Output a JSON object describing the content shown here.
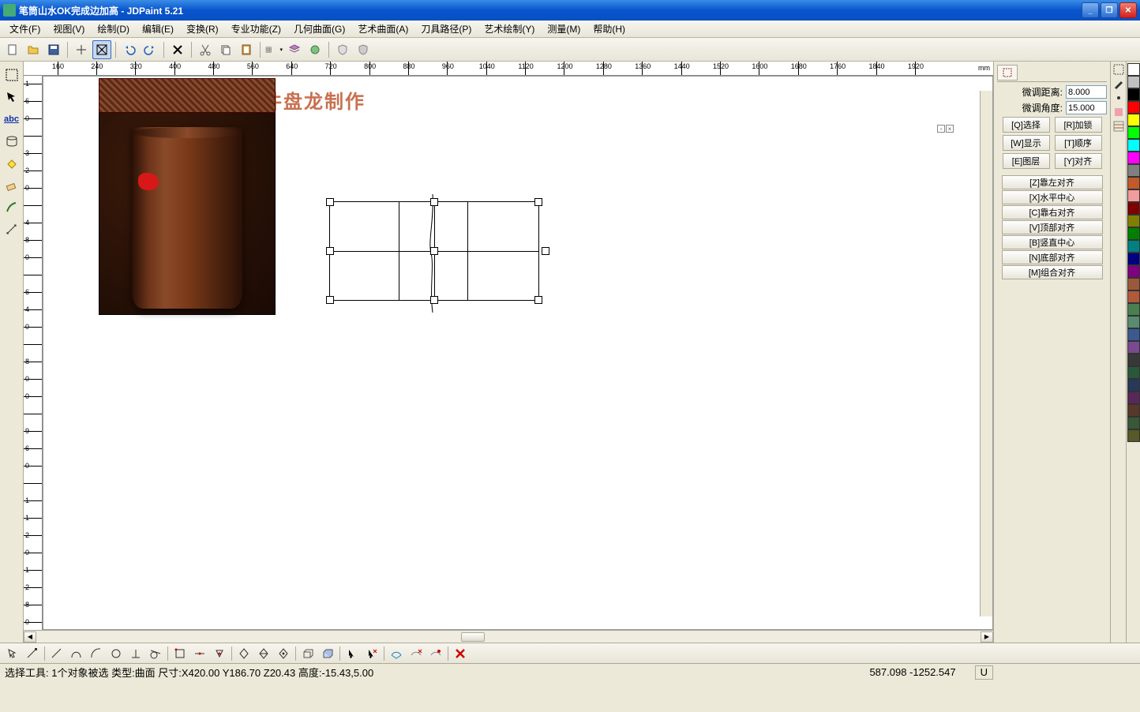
{
  "title": "笔筒山水OK完成边加高 - JDPaint 5.21",
  "menus": [
    "文件(F)",
    "视图(V)",
    "绘制(D)",
    "编辑(E)",
    "变换(R)",
    "专业功能(Z)",
    "几何曲面(G)",
    "艺术曲面(A)",
    "刀具路径(P)",
    "艺术绘制(Y)",
    "测量(M)",
    "帮助(H)"
  ],
  "ruler_unit": "mm",
  "ruler_h_ticks": [
    160,
    240,
    320,
    400,
    480,
    560,
    640,
    720,
    800,
    880,
    960,
    1040,
    1120,
    1200,
    1280,
    1360,
    1440,
    1520,
    1600,
    1680,
    1760,
    1840,
    1920
  ],
  "ruler_v_ticks": [
    "1",
    "6",
    "0",
    "",
    "3",
    "2",
    "0",
    "",
    "4",
    "8",
    "0",
    "",
    "6",
    "4",
    "0",
    "",
    "8",
    "0",
    "0",
    "",
    "9",
    "6",
    "0",
    "",
    "1",
    "1",
    "2",
    "0",
    "1",
    "2",
    "8",
    "0"
  ],
  "watermark": "精雕软件盘龙制作",
  "right_panel": {
    "nudge_dist_label": "微调距离:",
    "nudge_dist": "8.000",
    "nudge_ang_label": "微调角度:",
    "nudge_ang": "15.000",
    "btn_select": "[Q]选择",
    "btn_lock": "[R]加锁",
    "btn_show": "[W]显示",
    "btn_order": "[T]顺序",
    "btn_layer": "[E]图层",
    "btn_align": "[Y]对齐",
    "align_left": "[Z]靠左对齐",
    "align_hcenter": "[X]水平中心",
    "align_right": "[C]靠右对齐",
    "align_top": "[V]顶部对齐",
    "align_vcenter": "[B]竖直中心",
    "align_bottom": "[N]底部对齐",
    "align_group": "[M]组合对齐"
  },
  "colors": [
    "#ffffff",
    "#c0c0c0",
    "#000000",
    "#ff0000",
    "#ffff00",
    "#00ff00",
    "#00ffff",
    "#ff00ff",
    "#808080",
    "#c25a2a",
    "#f19c9c",
    "#800000",
    "#808000",
    "#008000",
    "#008080",
    "#000080",
    "#800080",
    "#9a5a3a",
    "#b05a3a",
    "#4a8050",
    "#5a8a70",
    "#3a5a90",
    "#7a4a90",
    "#383838",
    "#285838",
    "#283858",
    "#582858",
    "#583828",
    "#385838",
    "#585828"
  ],
  "status": {
    "text": "选择工具: 1个对象被选 类型:曲面 尺寸:X420.00 Y186.70 Z20.43 高度:-15.43,5.00",
    "coords": "587.098 -1252.547",
    "mode": "U"
  }
}
